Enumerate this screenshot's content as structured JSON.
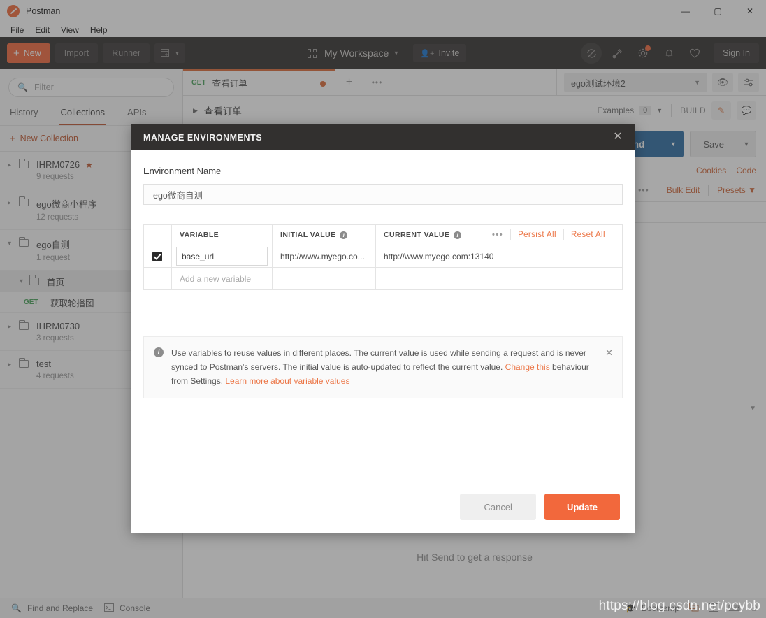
{
  "window": {
    "app_title": "Postman",
    "controls": {
      "minimize": "—",
      "maximize": "▢",
      "close": "✕"
    }
  },
  "menubar": {
    "items": [
      "File",
      "Edit",
      "View",
      "Help"
    ]
  },
  "toolbar": {
    "new_label": "New",
    "new_plus": "+",
    "import_label": "Import",
    "runner_label": "Runner",
    "workspace_label": "My Workspace",
    "invite_label": "Invite",
    "signin_label": "Sign In",
    "icons": [
      "sync-off-icon",
      "broadcast-icon",
      "gear-icon",
      "bell-icon",
      "heart-icon"
    ]
  },
  "sidebar": {
    "filter_placeholder": "Filter",
    "tabs": [
      {
        "label": "History",
        "selected": false
      },
      {
        "label": "Collections",
        "selected": true
      },
      {
        "label": "APIs",
        "selected": false
      }
    ],
    "new_collection_label": "New Collection",
    "collections": [
      {
        "name": "IHRM0726",
        "requests": "9 requests",
        "starred": true,
        "expanded": false
      },
      {
        "name": "ego微商小程序",
        "requests": "12 requests",
        "starred": false,
        "expanded": false
      },
      {
        "name": "ego自测",
        "requests": "1 request",
        "starred": false,
        "expanded": true
      },
      {
        "name": "IHRM0730",
        "requests": "3 requests",
        "starred": false,
        "expanded": false
      },
      {
        "name": "test",
        "requests": "4 requests",
        "starred": false,
        "expanded": false
      }
    ],
    "subfolder": {
      "name": "首页"
    },
    "request": {
      "method": "GET",
      "name": "获取轮播图"
    }
  },
  "main": {
    "tab": {
      "method": "GET",
      "name": "查看订单",
      "unsaved": true
    },
    "env_selector": {
      "value": "ego测试环境2"
    },
    "request_title": "查看订单",
    "examples_label": "Examples",
    "examples_count": "0",
    "build_label": "BUILD",
    "send_label": "Send",
    "save_label": "Save",
    "cookies_label": "Cookies",
    "code_label": "Code",
    "param_actions": {
      "bulk_edit": "Bulk Edit",
      "presets": "Presets"
    },
    "response_placeholder": "Hit Send to get a response"
  },
  "modal": {
    "title": "MANAGE ENVIRONMENTS",
    "env_name_label": "Environment Name",
    "env_name_value": "ego微商自测",
    "table": {
      "columns": [
        "",
        "VARIABLE",
        "INITIAL VALUE",
        "CURRENT VALUE"
      ],
      "actions": {
        "dots": "•••",
        "persist_all": "Persist All",
        "reset_all": "Reset All"
      },
      "rows": [
        {
          "checked": true,
          "variable": "base_url",
          "initial_value": "http://www.myego.co...",
          "current_value": "http://www.myego.com:13140"
        }
      ],
      "new_row_placeholder": "Add a new variable"
    },
    "info": {
      "text_1": "Use variables to reuse values in different places. The current value is used while sending a request and is never synced to Postman's servers. The initial value is auto-updated to reflect the current value. ",
      "link_1": "Change this",
      "text_2": " behaviour from Settings. ",
      "link_2": "Learn more about variable values"
    },
    "cancel_label": "Cancel",
    "update_label": "Update"
  },
  "statusbar": {
    "find_replace_label": "Find and Replace",
    "console_label": "Console",
    "bootcamp_label": "Bootcamp"
  },
  "watermark": "https://blog.csdn.net/pcybb",
  "colors": {
    "accent_orange": "#f2683c",
    "toolbar_dark": "#32302f",
    "send_blue": "#2d6ca3",
    "method_green": "#4aa35b"
  }
}
